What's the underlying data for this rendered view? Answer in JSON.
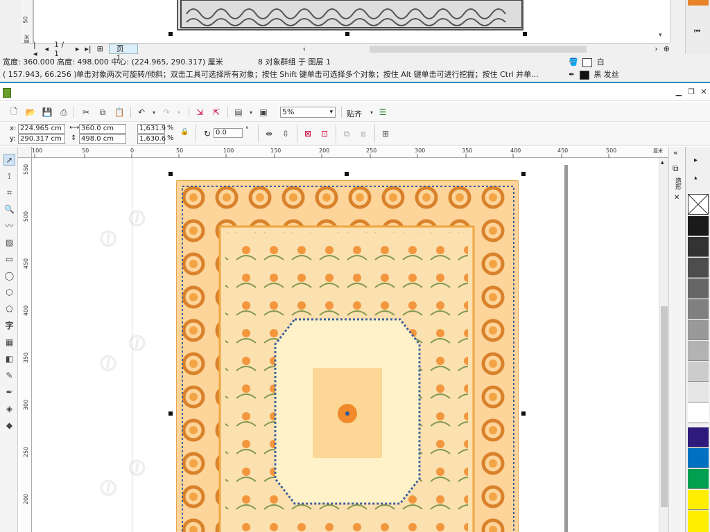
{
  "top_window": {
    "page_nav": {
      "counter": "1 / 1",
      "tab": "页 1"
    },
    "status_line1": {
      "text": "宽度: 360.000  高度: 498.000  中心: (224.965, 290.317)  厘米",
      "selection": "8 对象群组 于 图层 1",
      "fill_label": "白",
      "outline_label": "黑 发丝"
    },
    "status_line2": {
      "coords": "( 157.943, 66.256 )",
      "hint": "单击对象两次可旋转/倾斜；双击工具可选择所有对象；按住 Shift 键单击可选择多个对象；按住 Alt 键单击可进行挖掘；按住 Ctrl 并单..."
    },
    "ruler_label": "50",
    "ruler_unit": "厘米"
  },
  "toolbar": {
    "zoom": "5%",
    "snap": "贴齐"
  },
  "property_bar": {
    "x_label": "x:",
    "x_value": "224.965 cm",
    "y_label": "y:",
    "y_value": "290.317 cm",
    "width_value": "360.0 cm",
    "height_value": "498.0 cm",
    "scale_x": "1,631.9",
    "scale_y": "1,630.6",
    "percent": "%",
    "rotation": "0.0",
    "degree": "°"
  },
  "ruler_h": {
    "ticks": [
      "100",
      "50",
      "0",
      "50",
      "100",
      "150",
      "200",
      "250",
      "300",
      "350",
      "400",
      "450",
      "500"
    ],
    "unit": "厘米"
  },
  "ruler_v": {
    "ticks": [
      "550",
      "500",
      "450",
      "400",
      "350",
      "300",
      "250",
      "200"
    ]
  },
  "docker": {
    "label": "造形"
  },
  "colors": {
    "rug_bg": "#fbd79a",
    "rug_border": "#e0a850",
    "scroll_orange": "#e8832a",
    "palette": [
      "#ffffff",
      "#1a1a1a",
      "#333333",
      "#4d4d4d",
      "#666666",
      "#808080",
      "#999999",
      "#b3b3b3",
      "#cccccc",
      "#e6e6e6",
      "#ffffff",
      "#2e1a7a",
      "#0070c0",
      "#00a050",
      "#ffee00"
    ]
  }
}
